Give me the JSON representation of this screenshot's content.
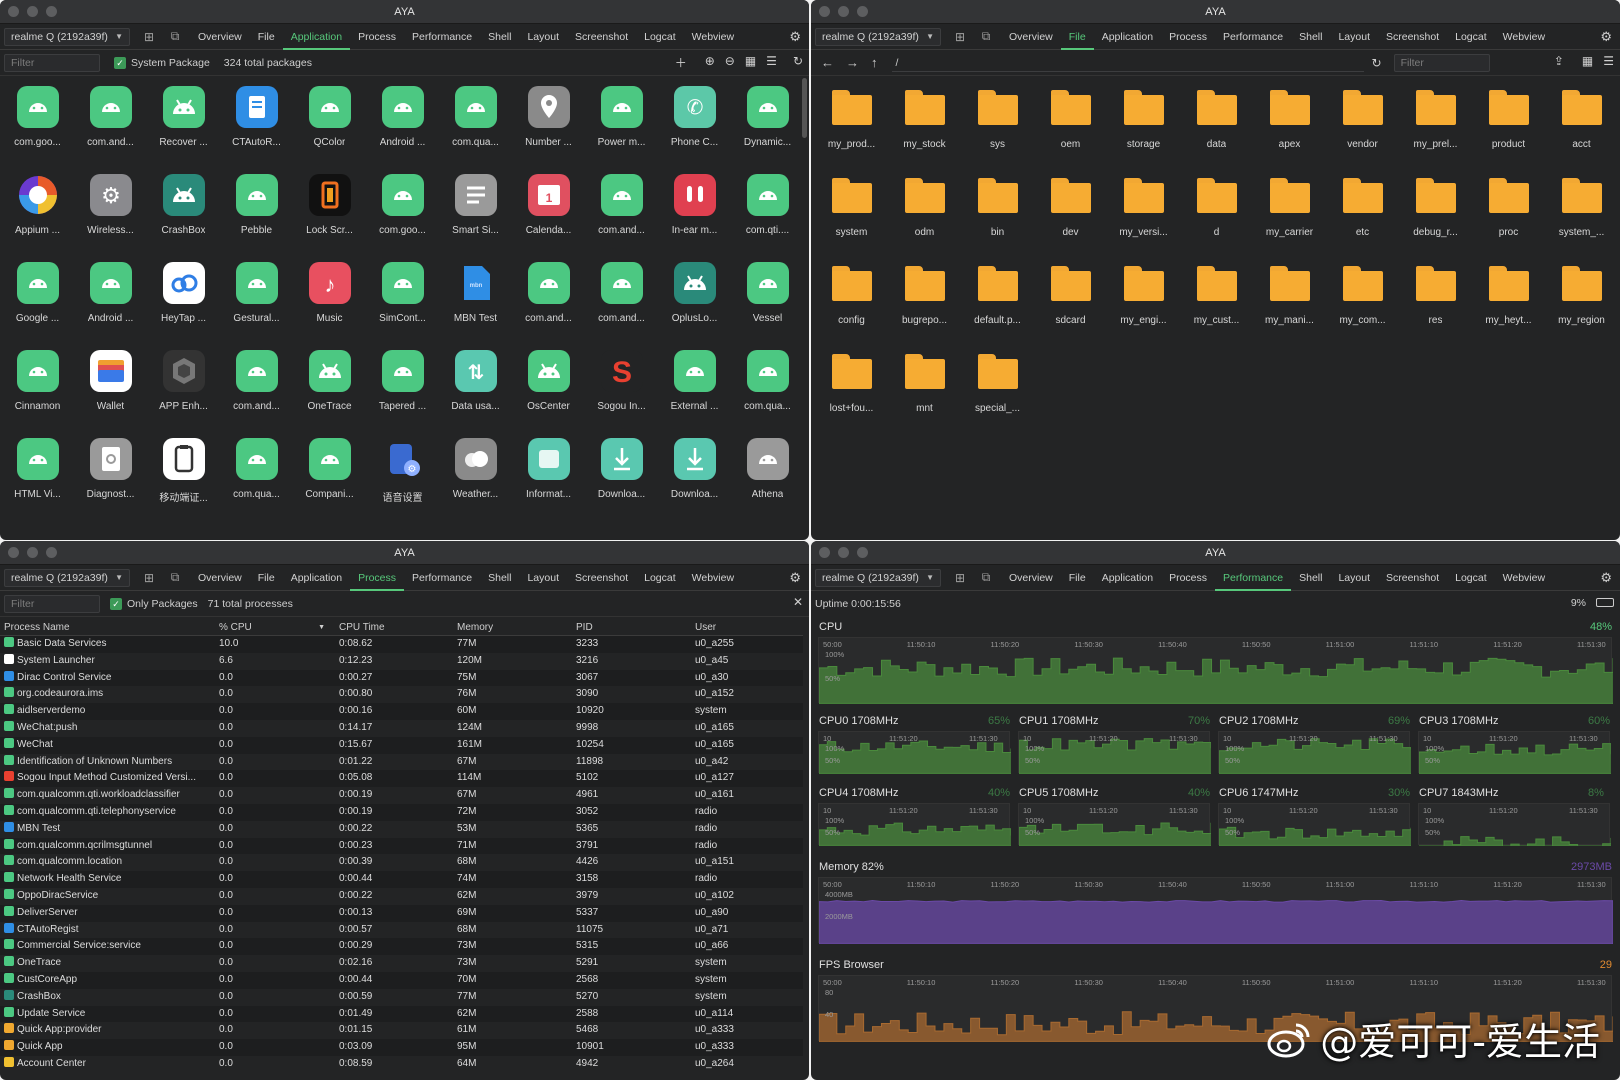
{
  "app_title": "AYA",
  "device": "realme Q (2192a39f)",
  "nav_tabs": [
    "Overview",
    "File",
    "Application",
    "Process",
    "Performance",
    "Shell",
    "Layout",
    "Screenshot",
    "Logcat",
    "Webview"
  ],
  "colors": {
    "accent": "#57c87b",
    "cpu_chart": "#4a8a3c",
    "memory_chart": "#6b4aa8",
    "fps_chart": "#a86a30",
    "folder": "#f6ac33",
    "app_green": "#4cc882"
  },
  "application": {
    "filter_placeholder": "Filter",
    "system_package_label": "System Package",
    "total_label": "324 total packages",
    "apps": [
      {
        "label": "com.goo...",
        "icon": "android",
        "color": "#4cc882"
      },
      {
        "label": "com.and...",
        "icon": "android",
        "color": "#4cc882"
      },
      {
        "label": "Recover ...",
        "icon": "android-robot",
        "color": "#4cc882"
      },
      {
        "label": "CTAutoR...",
        "icon": "document",
        "color": "#2f8ee5"
      },
      {
        "label": "QColor",
        "icon": "android",
        "color": "#4cc882"
      },
      {
        "label": "Android ...",
        "icon": "android",
        "color": "#4cc882"
      },
      {
        "label": "com.qua...",
        "icon": "android",
        "color": "#4cc882"
      },
      {
        "label": "Number ...",
        "icon": "location",
        "color": "#8a8a8a"
      },
      {
        "label": "Power m...",
        "icon": "android",
        "color": "#4cc882"
      },
      {
        "label": "Phone C...",
        "icon": "phone",
        "color": "#5cc8a8"
      },
      {
        "label": "Dynamic...",
        "icon": "android",
        "color": "#4cc882"
      },
      {
        "label": "Appium ...",
        "icon": "appium",
        "color": "#e85a2a"
      },
      {
        "label": "Wireless...",
        "icon": "gear",
        "color": "#8a8a8e"
      },
      {
        "label": "CrashBox",
        "icon": "android-robot",
        "color": "#2a8a7a"
      },
      {
        "label": "Pebble",
        "icon": "android",
        "color": "#4cc882"
      },
      {
        "label": "Lock Scr...",
        "icon": "lock-screen",
        "color": "#111111"
      },
      {
        "label": "com.goo...",
        "icon": "android",
        "color": "#4cc882"
      },
      {
        "label": "Smart Si...",
        "icon": "menu",
        "color": "#9a9a9a"
      },
      {
        "label": "Calenda...",
        "icon": "calendar",
        "color": "#e05060"
      },
      {
        "label": "com.and...",
        "icon": "android",
        "color": "#4cc882"
      },
      {
        "label": "In-ear m...",
        "icon": "earbuds",
        "color": "#e04050"
      },
      {
        "label": "com.qti....",
        "icon": "android",
        "color": "#4cc882"
      },
      {
        "label": "Google ...",
        "icon": "android",
        "color": "#4cc882"
      },
      {
        "label": "Android ...",
        "icon": "android",
        "color": "#4cc882"
      },
      {
        "label": "HeyTap ...",
        "icon": "cloud",
        "color": "#ffffff"
      },
      {
        "label": "Gestural...",
        "icon": "android",
        "color": "#4cc882"
      },
      {
        "label": "Music",
        "icon": "music",
        "color": "#e85060"
      },
      {
        "label": "SimCont...",
        "icon": "android",
        "color": "#4cc882"
      },
      {
        "label": "MBN Test",
        "icon": "file",
        "color": "#2f8ee5"
      },
      {
        "label": "com.and...",
        "icon": "android",
        "color": "#4cc882"
      },
      {
        "label": "com.and...",
        "icon": "android",
        "color": "#4cc882"
      },
      {
        "label": "OplusLo...",
        "icon": "android-robot",
        "color": "#2a8a7a"
      },
      {
        "label": "Vessel",
        "icon": "android",
        "color": "#4cc882"
      },
      {
        "label": "Cinnamon",
        "icon": "android",
        "color": "#4cc882"
      },
      {
        "label": "Wallet",
        "icon": "wallet",
        "color": "#ffffff"
      },
      {
        "label": "APP Enh...",
        "icon": "hexagon",
        "color": "#333333"
      },
      {
        "label": "com.and...",
        "icon": "android",
        "color": "#4cc882"
      },
      {
        "label": "OneTrace",
        "icon": "android-robot",
        "color": "#4cc882"
      },
      {
        "label": "Tapered ...",
        "icon": "android",
        "color": "#4cc882"
      },
      {
        "label": "Data usa...",
        "icon": "data-usage",
        "color": "#5ac8b0"
      },
      {
        "label": "OsCenter",
        "icon": "android-robot",
        "color": "#4cc882"
      },
      {
        "label": "Sogou In...",
        "icon": "sogou",
        "color": "#e84030"
      },
      {
        "label": "External ...",
        "icon": "android",
        "color": "#4cc882"
      },
      {
        "label": "com.qua...",
        "icon": "android",
        "color": "#4cc882"
      },
      {
        "label": "HTML Vi...",
        "icon": "android",
        "color": "#4cc882"
      },
      {
        "label": "Diagnost...",
        "icon": "diagnostic",
        "color": "#9a9a9a"
      },
      {
        "label": "移动端证...",
        "icon": "clipboard",
        "color": "#ffffff"
      },
      {
        "label": "com.qua...",
        "icon": "android",
        "color": "#4cc882"
      },
      {
        "label": "Compani...",
        "icon": "android",
        "color": "#4cc882"
      },
      {
        "label": "语音设置",
        "icon": "voice-settings",
        "color": "#3a6ad0"
      },
      {
        "label": "Weather...",
        "icon": "weather",
        "color": "#8a8a8a"
      },
      {
        "label": "Informat...",
        "icon": "info-cards",
        "color": "#5ac8b0"
      },
      {
        "label": "Downloa...",
        "icon": "download",
        "color": "#5ac8b0"
      },
      {
        "label": "Downloa...",
        "icon": "download",
        "color": "#5ac8b0"
      },
      {
        "label": "Athena",
        "icon": "android",
        "color": "#9a9a9a"
      }
    ]
  },
  "file": {
    "path": "/",
    "filter_placeholder": "Filter",
    "folders": [
      "my_prod...",
      "my_stock",
      "sys",
      "oem",
      "storage",
      "data",
      "apex",
      "vendor",
      "my_prel...",
      "product",
      "acct",
      "system",
      "odm",
      "bin",
      "dev",
      "my_versi...",
      "d",
      "my_carrier",
      "etc",
      "debug_r...",
      "proc",
      "system_...",
      "config",
      "bugrepo...",
      "default.p...",
      "sdcard",
      "my_engi...",
      "my_cust...",
      "my_mani...",
      "my_com...",
      "res",
      "my_heyt...",
      "my_region",
      "lost+fou...",
      "mnt",
      "special_..."
    ]
  },
  "process": {
    "filter_placeholder": "Filter",
    "only_packages_label": "Only Packages",
    "total_label": "71 total processes",
    "columns": [
      "Process Name",
      "% CPU",
      "CPU Time",
      "Memory",
      "PID",
      "User"
    ],
    "rows": [
      [
        "Basic Data Services",
        "10.0",
        "0:08.62",
        "77M",
        "3233",
        "u0_a255"
      ],
      [
        "System Launcher",
        "6.6",
        "0:12.23",
        "120M",
        "3216",
        "u0_a45"
      ],
      [
        "Dirac Control Service",
        "0.0",
        "0:00.27",
        "75M",
        "3067",
        "u0_a30"
      ],
      [
        "org.codeaurora.ims",
        "0.0",
        "0:00.80",
        "76M",
        "3090",
        "u0_a152"
      ],
      [
        "aidlserverdemo",
        "0.0",
        "0:00.16",
        "60M",
        "10920",
        "system"
      ],
      [
        "WeChat:push",
        "0.0",
        "0:14.17",
        "124M",
        "9998",
        "u0_a165"
      ],
      [
        "WeChat",
        "0.0",
        "0:15.67",
        "161M",
        "10254",
        "u0_a165"
      ],
      [
        "Identification of Unknown Numbers",
        "0.0",
        "0:01.22",
        "67M",
        "11898",
        "u0_a42"
      ],
      [
        "Sogou Input Method Customized Versi...",
        "0.0",
        "0:05.08",
        "114M",
        "5102",
        "u0_a127"
      ],
      [
        "com.qualcomm.qti.workloadclassifier",
        "0.0",
        "0:00.19",
        "67M",
        "4961",
        "u0_a161"
      ],
      [
        "com.qualcomm.qti.telephonyservice",
        "0.0",
        "0:00.19",
        "72M",
        "3052",
        "radio"
      ],
      [
        "MBN Test",
        "0.0",
        "0:00.22",
        "53M",
        "5365",
        "radio"
      ],
      [
        "com.qualcomm.qcrilmsgtunnel",
        "0.0",
        "0:00.23",
        "71M",
        "3791",
        "radio"
      ],
      [
        "com.qualcomm.location",
        "0.0",
        "0:00.39",
        "68M",
        "4426",
        "u0_a151"
      ],
      [
        "Network Health Service",
        "0.0",
        "0:00.44",
        "74M",
        "3158",
        "radio"
      ],
      [
        "OppoDiracService",
        "0.0",
        "0:00.22",
        "62M",
        "3979",
        "u0_a102"
      ],
      [
        "DeliverServer",
        "0.0",
        "0:00.13",
        "69M",
        "5337",
        "u0_a90"
      ],
      [
        "CTAutoRegist",
        "0.0",
        "0:00.57",
        "68M",
        "11075",
        "u0_a71"
      ],
      [
        "Commercial Service:service",
        "0.0",
        "0:00.29",
        "73M",
        "5315",
        "u0_a66"
      ],
      [
        "OneTrace",
        "0.0",
        "0:02.16",
        "73M",
        "5291",
        "system"
      ],
      [
        "CustCoreApp",
        "0.0",
        "0:00.44",
        "70M",
        "2568",
        "system"
      ],
      [
        "CrashBox",
        "0.0",
        "0:00.59",
        "77M",
        "5270",
        "system"
      ],
      [
        "Update Service",
        "0.0",
        "0:01.49",
        "62M",
        "2588",
        "u0_a114"
      ],
      [
        "Quick App:provider",
        "0.0",
        "0:01.15",
        "61M",
        "5468",
        "u0_a333"
      ],
      [
        "Quick App",
        "0.0",
        "0:03.09",
        "95M",
        "10901",
        "u0_a333"
      ],
      [
        "Account Center",
        "0.0",
        "0:08.59",
        "64M",
        "4942",
        "u0_a264"
      ]
    ],
    "row_icon_colors": [
      "#4cc882",
      "#ffffff",
      "#2f8ee5",
      "#4cc882",
      "#4cc882",
      "#4cc882",
      "#4cc882",
      "#4cc882",
      "#e84030",
      "#4cc882",
      "#4cc882",
      "#2f8ee5",
      "#4cc882",
      "#4cc882",
      "#4cc882",
      "#4cc882",
      "#4cc882",
      "#2f8ee5",
      "#4cc882",
      "#4cc882",
      "#4cc882",
      "#2a8a7a",
      "#4cc882",
      "#f0a830",
      "#f0a830",
      "#f0c030"
    ]
  },
  "performance": {
    "uptime": "Uptime 0:00:15:56",
    "battery": "9%",
    "cpu": {
      "title": "CPU",
      "percent": "48%",
      "y_labels": [
        "100%",
        "50%"
      ],
      "x_ticks": [
        "50:00",
        "11:50:10",
        "11:50:20",
        "11:50:30",
        "11:50:40",
        "11:50:50",
        "11:51:00",
        "11:51:10",
        "11:51:20",
        "11:51:30"
      ]
    },
    "cores": [
      {
        "title": "CPU0 1708MHz",
        "percent": "65%"
      },
      {
        "title": "CPU1 1708MHz",
        "percent": "70%"
      },
      {
        "title": "CPU2 1708MHz",
        "percent": "69%"
      },
      {
        "title": "CPU3 1708MHz",
        "percent": "60%"
      },
      {
        "title": "CPU4 1708MHz",
        "percent": "40%"
      },
      {
        "title": "CPU5 1708MHz",
        "percent": "40%"
      },
      {
        "title": "CPU6 1747MHz",
        "percent": "30%"
      },
      {
        "title": "CPU7 1843MHz",
        "percent": "8%"
      }
    ],
    "core_ticks": [
      "10",
      "11:51:20",
      "11:51:30"
    ],
    "core_ylabels": [
      "100%",
      "50%"
    ],
    "memory": {
      "title": "Memory 82%",
      "value": "2973MB",
      "y_labels": [
        "4000MB",
        "2000MB"
      ],
      "x_ticks": [
        "50:00",
        "11:50:10",
        "11:50:20",
        "11:50:30",
        "11:50:40",
        "11:50:50",
        "11:51:00",
        "11:51:10",
        "11:51:20",
        "11:51:30"
      ]
    },
    "fps": {
      "title": "FPS Browser",
      "value": "29",
      "y_labels": [
        "80",
        "40"
      ],
      "x_ticks": [
        "50:00",
        "11:50:10",
        "11:50:20",
        "11:50:30",
        "11:50:40",
        "11:50:50",
        "11:51:00",
        "11:51:10",
        "11:51:20",
        "11:51:30"
      ]
    }
  },
  "watermark": {
    "text": "@爱可可-爱生活"
  }
}
